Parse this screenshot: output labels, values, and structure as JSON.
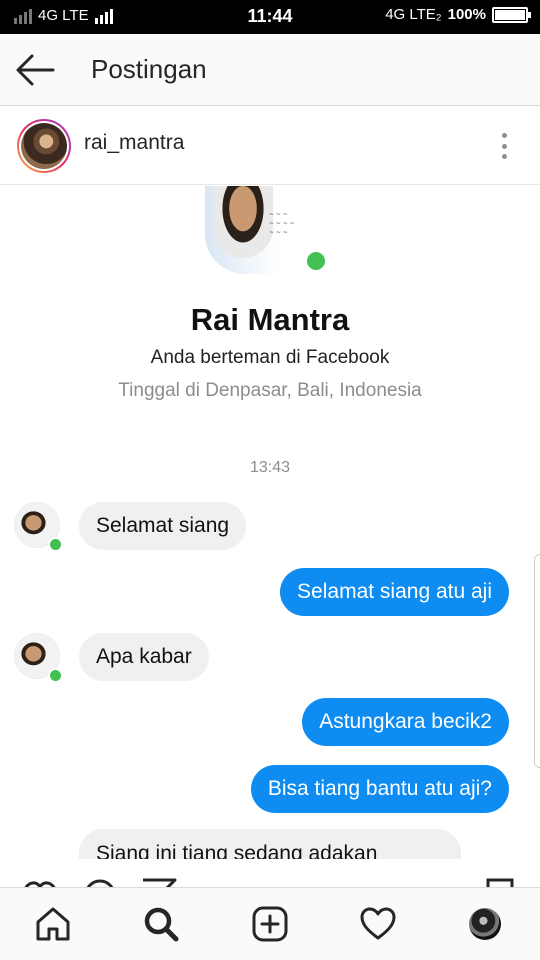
{
  "status_bar": {
    "network_left": "4G LTE",
    "time": "11:44",
    "network_right": "4G LTE₂",
    "battery": "100%"
  },
  "header": {
    "title": "Postingan",
    "back_icon": "arrow-left-icon"
  },
  "post": {
    "username": "rai_mantra",
    "more_icon": "more-vertical-icon"
  },
  "conversation": {
    "contact_name": "Rai Mantra",
    "friend_status": "Anda berteman di Facebook",
    "location": "Tinggal di Denpasar, Bali, Indonesia",
    "timestamp": "13:43",
    "messages": [
      {
        "direction": "in",
        "text": "Selamat siang"
      },
      {
        "direction": "out",
        "text": "Selamat siang atu aji"
      },
      {
        "direction": "in",
        "text": "Apa kabar"
      },
      {
        "direction": "out",
        "text": "Astungkara becik2"
      },
      {
        "direction": "out",
        "text": "Bisa tiang bantu atu aji?"
      },
      {
        "direction": "in",
        "text": "Siang ini tiang sedang adakan"
      }
    ]
  },
  "colors": {
    "outgoing_bubble": "#0e8cf1",
    "incoming_bubble": "#f0f0f0",
    "online_dot": "#44c053"
  },
  "bottom_nav": {
    "items": [
      "home-icon",
      "search-icon",
      "add-post-icon",
      "heart-icon",
      "profile-avatar"
    ],
    "active": "search-icon"
  }
}
